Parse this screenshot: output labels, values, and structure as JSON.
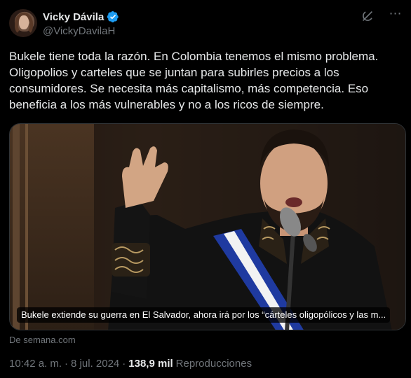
{
  "author": {
    "display_name": "Vicky Dávila",
    "handle": "@VickyDavilaH",
    "verified": true
  },
  "icons": {
    "verified": "verified-badge-icon",
    "grok": "grok-icon",
    "more": "more-options-icon"
  },
  "colors": {
    "accent": "#1d9bf0",
    "background": "#000000",
    "text": "#e7e9ea",
    "muted": "#71767b"
  },
  "tweet": {
    "text": "Bukele tiene toda la razón. En Colombia tenemos el mismo problema.\nOligopolios y carteles que se juntan para subirles precios a los\nconsumidores. Se necesita más capitalismo, más competencia. Eso\nbeneficia a los más vulnerables y no a los ricos de siempre."
  },
  "card": {
    "caption": "Bukele extiende su guerra en El Salvador, ahora irá por los “cárteles oligopólicos y las m...",
    "source": "De semana.com"
  },
  "meta": {
    "time": "10:42 a. m.",
    "separator1": "·",
    "date": "8 jul. 2024",
    "separator2": "·",
    "views_count": "138,9 mil",
    "views_label": "Reproducciones"
  }
}
